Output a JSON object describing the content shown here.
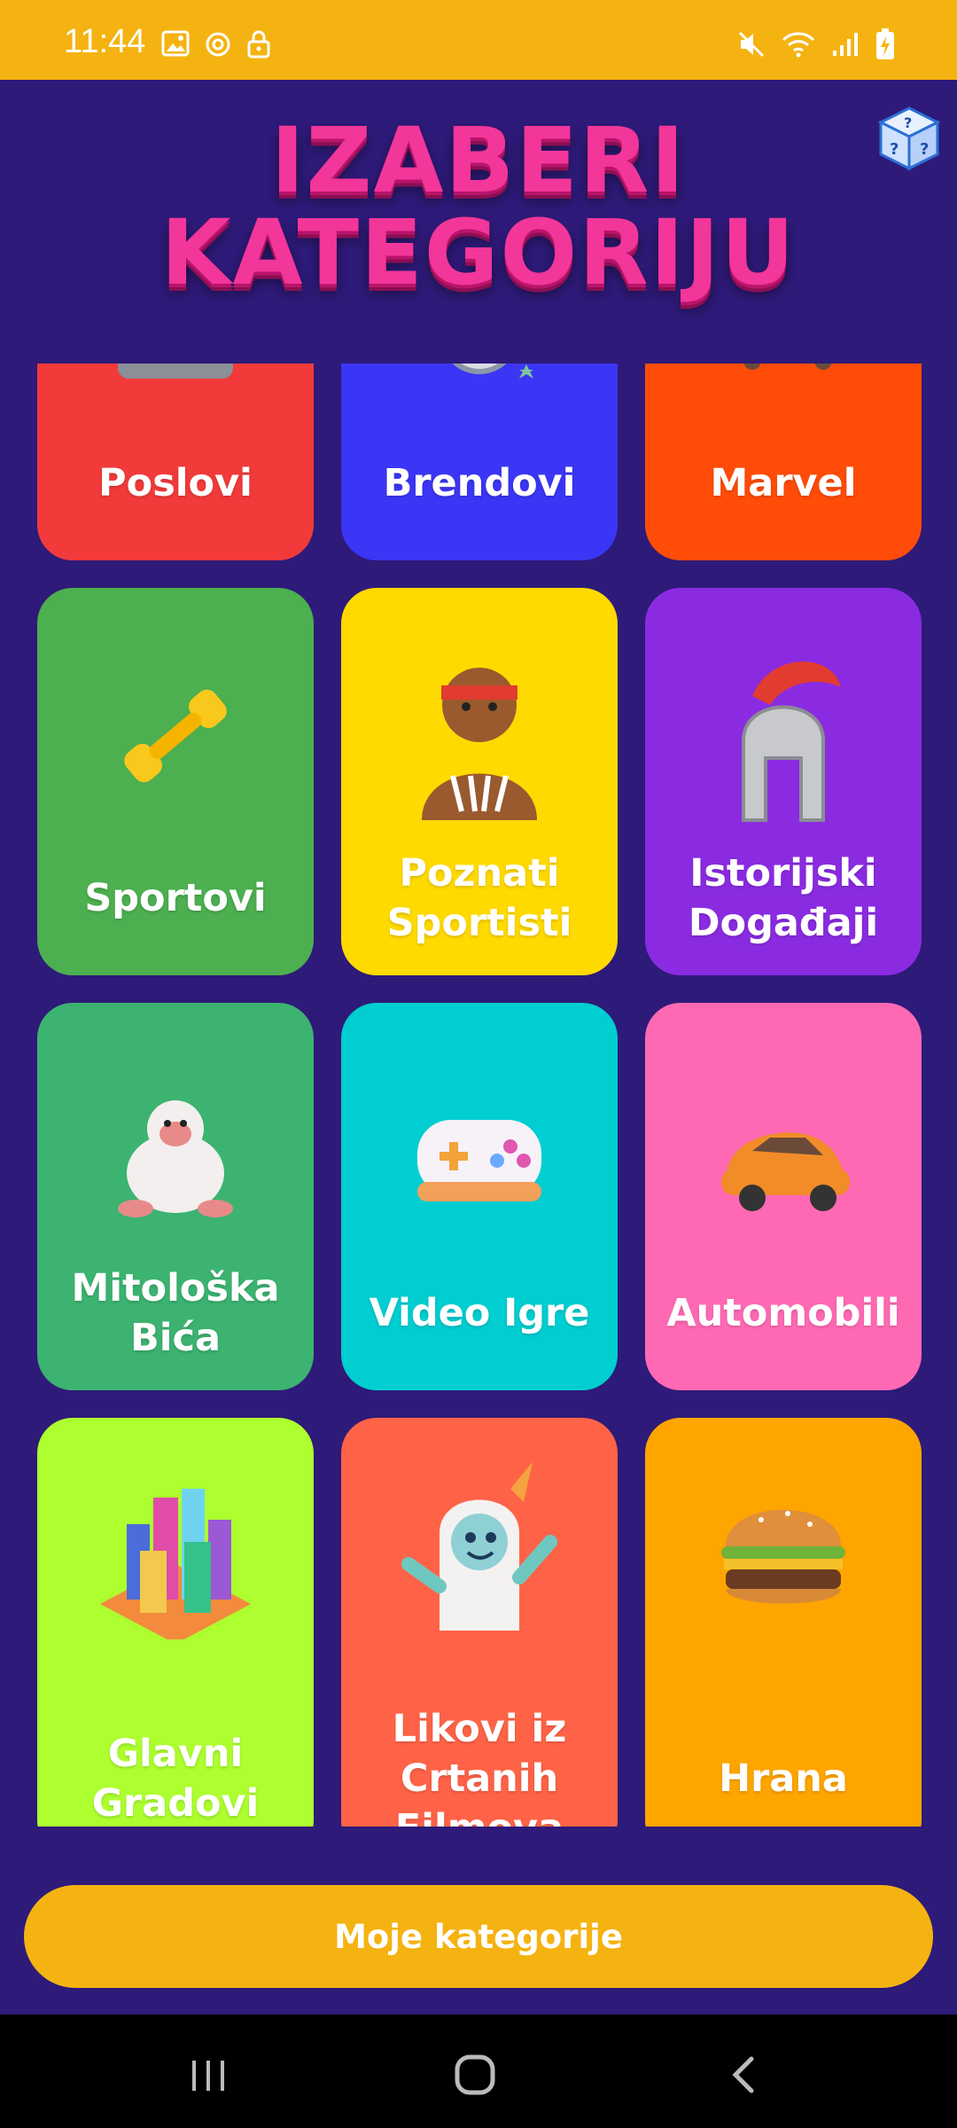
{
  "status_bar": {
    "time": "11:44",
    "left_icons": [
      "gallery-icon",
      "sync-icon",
      "lock-icon"
    ],
    "right_icons": [
      "mute-icon",
      "wifi-icon",
      "signal-icon",
      "battery-charging-icon"
    ]
  },
  "header": {
    "title_line1": "IZABERI",
    "title_line2": "KATEGORIJU",
    "title_color": "#F2369A",
    "random_icon": "dice-icon"
  },
  "categories": [
    {
      "label": "Poslovi",
      "color": "#F23A3A",
      "icon": "briefcase-icon"
    },
    {
      "label": "Brendovi",
      "color": "#3B36F5",
      "icon": "brand-logo-icon"
    },
    {
      "label": "Marvel",
      "color": "#FF4C08",
      "icon": "marvel-icon"
    },
    {
      "label": "Sportovi",
      "color": "#4CAF50",
      "icon": "dumbbell-icon"
    },
    {
      "label": "Poznati\nSportisti",
      "color": "#FFDA00",
      "icon": "athlete-figure-icon"
    },
    {
      "label": "Istorijski\nDogađaji",
      "color": "#8A2BE2",
      "icon": "roman-helmet-icon"
    },
    {
      "label": "Mitološka\nBića",
      "color": "#3CB371",
      "icon": "yeti-icon"
    },
    {
      "label": "Video Igre",
      "color": "#00CED1",
      "icon": "gamepad-icon"
    },
    {
      "label": "Automobili",
      "color": "#FF69B4",
      "icon": "car-icon"
    },
    {
      "label": "Glavni\nGradovi",
      "color": "#ADFF2F",
      "icon": "city-icon"
    },
    {
      "label": "Likovi iz\nCrtanih\nFilmova",
      "color": "#FF6347",
      "icon": "cartoon-monster-icon"
    },
    {
      "label": "Hrana",
      "color": "#FFA500",
      "icon": "burger-icon"
    }
  ],
  "bottom_button": {
    "label": "Moje kategorije",
    "color": "#F5B311"
  },
  "nav_bar": {
    "icons": [
      "recents-icon",
      "home-icon",
      "back-icon"
    ]
  },
  "colors": {
    "background": "#2E1A78",
    "status_bar": "#F5B311"
  }
}
